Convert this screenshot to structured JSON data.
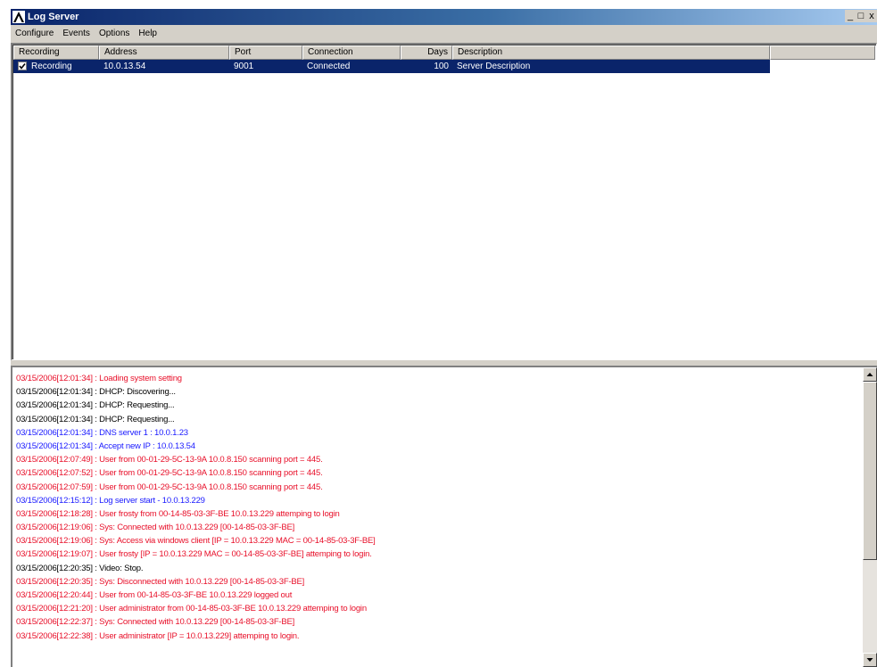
{
  "window": {
    "title": "Log Server",
    "controls": {
      "minimize": "_",
      "maximize": "□",
      "close": "x"
    }
  },
  "menu": [
    {
      "label": "Configure"
    },
    {
      "label": "Events"
    },
    {
      "label": "Options"
    },
    {
      "label": "Help"
    }
  ],
  "servers": {
    "columns": [
      "Recording",
      "Address",
      "Port",
      "Connection",
      "Days",
      "Description"
    ],
    "rows": [
      {
        "recording_checked": true,
        "recording": "Recording",
        "address": "10.0.13.54",
        "port": "9001",
        "connection": "Connected",
        "days": "100",
        "description": "Server Description",
        "selected": true
      }
    ]
  },
  "log": {
    "colors": {
      "red": "#e8102a",
      "black": "#000000",
      "blue": "#1a1aff"
    },
    "lines": [
      {
        "text": "03/15/2006[12:01:34] : Loading system setting",
        "color": "red"
      },
      {
        "text": "03/15/2006[12:01:34] : DHCP: Discovering...",
        "color": "black"
      },
      {
        "text": "03/15/2006[12:01:34] : DHCP: Requesting...",
        "color": "black"
      },
      {
        "text": "03/15/2006[12:01:34] : DHCP: Requesting...",
        "color": "black"
      },
      {
        "text": "03/15/2006[12:01:34] : DNS server 1 : 10.0.1.23",
        "color": "blue"
      },
      {
        "text": "03/15/2006[12:01:34] : Accept new IP : 10.0.13.54",
        "color": "blue"
      },
      {
        "text": "03/15/2006[12:07:49] : User from 00-01-29-5C-13-9A 10.0.8.150 scanning port = 445.",
        "color": "red"
      },
      {
        "text": "03/15/2006[12:07:52] : User from 00-01-29-5C-13-9A 10.0.8.150 scanning port = 445.",
        "color": "red"
      },
      {
        "text": "03/15/2006[12:07:59] : User from 00-01-29-5C-13-9A 10.0.8.150 scanning port = 445.",
        "color": "red"
      },
      {
        "text": "03/15/2006[12:15:12] : Log server start - 10.0.13.229",
        "color": "blue"
      },
      {
        "text": "03/15/2006[12:18:28] : User frosty from 00-14-85-03-3F-BE 10.0.13.229 attemping to login",
        "color": "red"
      },
      {
        "text": "03/15/2006[12:19:06] : Sys: Connected with 10.0.13.229 [00-14-85-03-3F-BE]",
        "color": "red"
      },
      {
        "text": "03/15/2006[12:19:06] : Sys: Access via windows client [IP = 10.0.13.229 MAC = 00-14-85-03-3F-BE]",
        "color": "red"
      },
      {
        "text": "03/15/2006[12:19:07] : User frosty [IP = 10.0.13.229 MAC = 00-14-85-03-3F-BE] attemping to login.",
        "color": "red"
      },
      {
        "text": "03/15/2006[12:20:35] : Video: Stop.",
        "color": "black"
      },
      {
        "text": "03/15/2006[12:20:35] : Sys: Disconnected with 10.0.13.229 [00-14-85-03-3F-BE]",
        "color": "red"
      },
      {
        "text": "03/15/2006[12:20:44] : User from 00-14-85-03-3F-BE 10.0.13.229 logged out",
        "color": "red"
      },
      {
        "text": "03/15/2006[12:21:20] : User administrator from 00-14-85-03-3F-BE 10.0.13.229 attemping to login",
        "color": "red"
      },
      {
        "text": "03/15/2006[12:22:37] : Sys: Connected with 10.0.13.229 [00-14-85-03-3F-BE]",
        "color": "red"
      },
      {
        "text": "03/15/2006[12:22:38] : User administrator [IP = 10.0.13.229] attemping to login.",
        "color": "red"
      }
    ]
  }
}
